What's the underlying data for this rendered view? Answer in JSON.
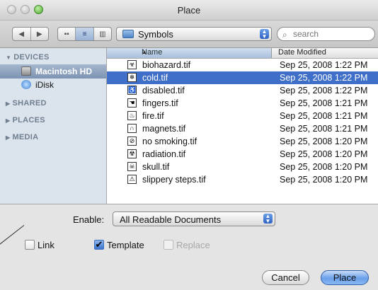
{
  "window": {
    "title": "Place"
  },
  "toolbar": {
    "nav": [
      "◀",
      "▶"
    ],
    "view": [
      "▪▪",
      "≡",
      "▥"
    ],
    "location": "Symbols",
    "search_placeholder": "search"
  },
  "sidebar": {
    "devices_header": "DEVICES",
    "devices": [
      {
        "label": "Macintosh HD",
        "icon": "hard-drive-icon",
        "selected": true
      },
      {
        "label": "iDisk",
        "icon": "idisk-icon",
        "selected": false
      }
    ],
    "collapsed": [
      "SHARED",
      "PLACES",
      "MEDIA"
    ]
  },
  "filelist": {
    "col_name": "Name",
    "col_date": "Date Modified",
    "rows": [
      {
        "name": "biohazard.tif",
        "date": "Sep 25, 2008 1:22 PM",
        "icon": "biohazard-icon",
        "glyph": "☣",
        "selected": false
      },
      {
        "name": "cold.tif",
        "date": "Sep 25, 2008 1:22 PM",
        "icon": "snowflake-icon",
        "glyph": "❄",
        "selected": true
      },
      {
        "name": "disabled.tif",
        "date": "Sep 25, 2008 1:22 PM",
        "icon": "wheelchair-icon",
        "glyph": "♿",
        "selected": false
      },
      {
        "name": "fingers.tif",
        "date": "Sep 25, 2008 1:21 PM",
        "icon": "hand-icon",
        "glyph": "☚",
        "selected": false
      },
      {
        "name": "fire.tif",
        "date": "Sep 25, 2008 1:21 PM",
        "icon": "flame-icon",
        "glyph": "♨",
        "selected": false
      },
      {
        "name": "magnets.tif",
        "date": "Sep 25, 2008 1:21 PM",
        "icon": "magnet-icon",
        "glyph": "∩",
        "selected": false
      },
      {
        "name": "no smoking.tif",
        "date": "Sep 25, 2008 1:20 PM",
        "icon": "no-smoking-icon",
        "glyph": "⊘",
        "selected": false
      },
      {
        "name": "radiation.tif",
        "date": "Sep 25, 2008 1:20 PM",
        "icon": "radiation-icon",
        "glyph": "☢",
        "selected": false
      },
      {
        "name": "skull.tif",
        "date": "Sep 25, 2008 1:20 PM",
        "icon": "skull-icon",
        "glyph": "☠",
        "selected": false
      },
      {
        "name": "slippery steps.tif",
        "date": "Sep 25, 2008 1:20 PM",
        "icon": "slip-icon",
        "glyph": "⚠",
        "selected": false
      }
    ]
  },
  "options": {
    "enable_label": "Enable:",
    "enable_value": "All Readable Documents",
    "link_label": "Link",
    "template_label": "Template",
    "replace_label": "Replace"
  },
  "buttons": {
    "cancel": "Cancel",
    "place": "Place"
  },
  "colors": {
    "selection": "#3f6fc8",
    "sidebar_bg": "#dbe3ec",
    "default_button": "#6aa0ea"
  }
}
